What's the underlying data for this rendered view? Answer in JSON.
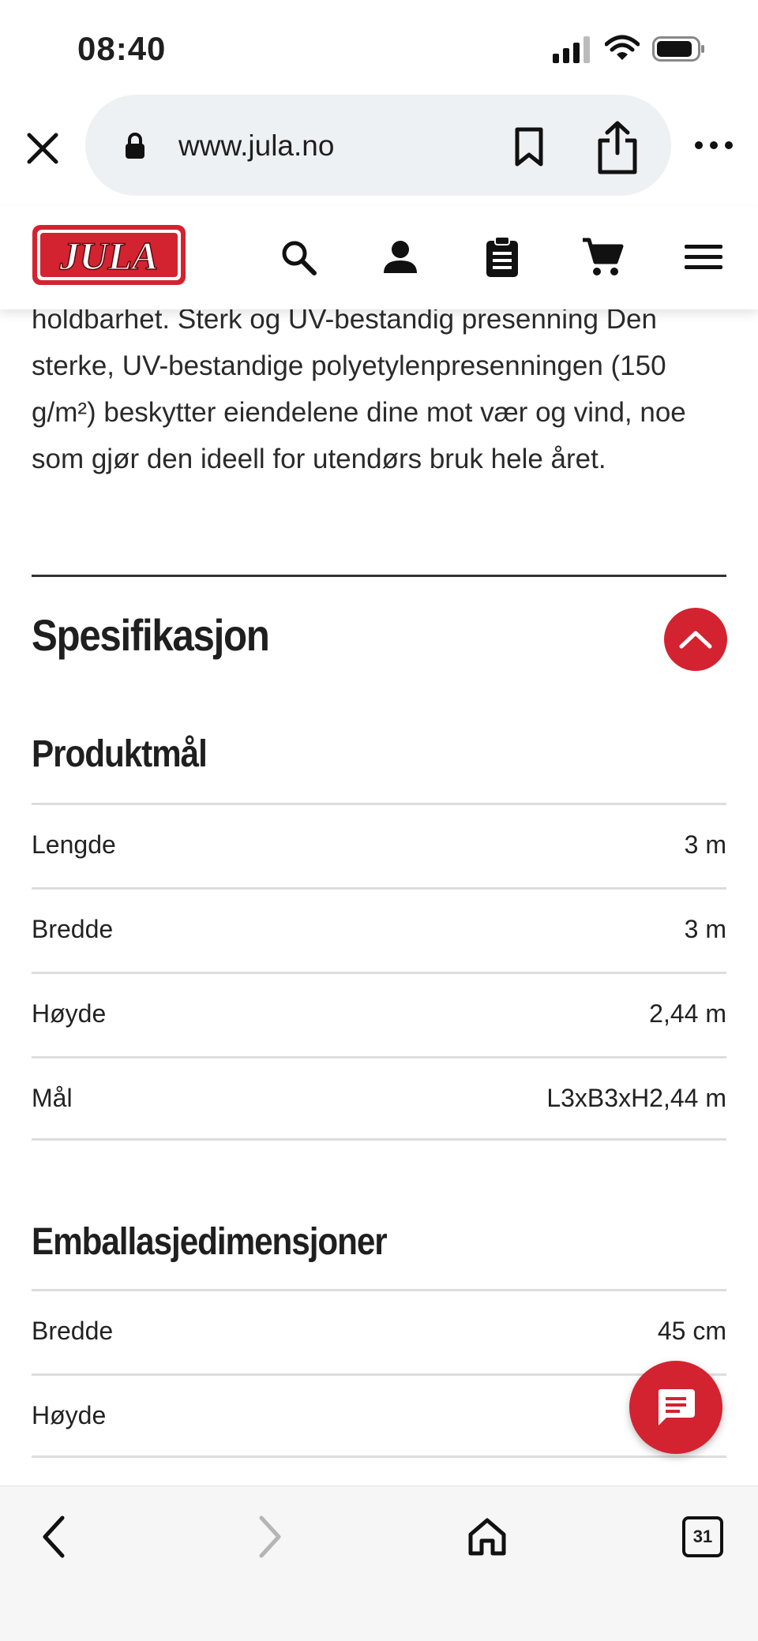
{
  "status_bar": {
    "time": "08:40"
  },
  "browser": {
    "url": "www.jula.no"
  },
  "site": {
    "logo_text": "JULA",
    "brand_color": "#d32330"
  },
  "description": "holdbarhet. Sterk og UV-bestandig presenning Den sterke, UV-bestandige polyetylenpresenningen (150 g/m²) beskytter eiendelene dine mot vær og vind, noe som gjør den ideell for utendørs bruk hele året.",
  "specification": {
    "heading": "Spesifikasjon",
    "groups": [
      {
        "title": "Produktmål",
        "rows": [
          {
            "label": "Lengde",
            "value": "3 m"
          },
          {
            "label": "Bredde",
            "value": "3 m"
          },
          {
            "label": "Høyde",
            "value": "2,44 m"
          },
          {
            "label": "Mål",
            "value": "L3xB3xH2,44 m"
          }
        ]
      },
      {
        "title": "Emballasjedimensjoner",
        "rows": [
          {
            "label": "Bredde",
            "value": "45 cm"
          },
          {
            "label": "Høyde",
            "value": ""
          }
        ]
      }
    ]
  },
  "bottom_nav": {
    "tabs_count": "31"
  },
  "icons": {
    "header": [
      "search-icon",
      "account-icon",
      "clipboard-icon",
      "cart-icon",
      "menu-icon"
    ],
    "browser": [
      "close-icon",
      "lock-icon",
      "bookmark-icon",
      "share-icon",
      "more-icon"
    ],
    "bottom": [
      "back-icon",
      "forward-icon",
      "home-icon",
      "tabs-icon"
    ]
  }
}
